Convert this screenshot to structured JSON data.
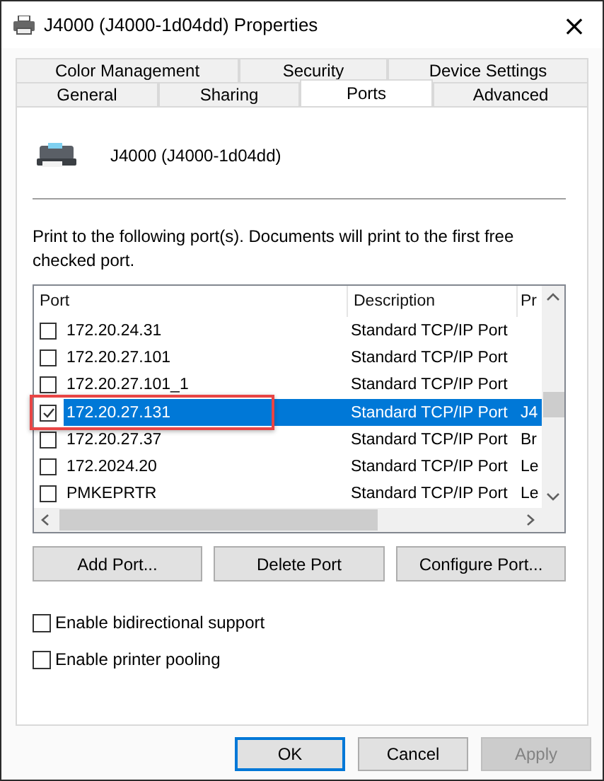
{
  "window": {
    "title": "J4000 (J4000-1d04dd) Properties",
    "close": "×"
  },
  "tab_rows": [
    [
      {
        "label": "Color Management",
        "selected": false
      },
      {
        "label": "Security",
        "selected": false
      },
      {
        "label": "Device Settings",
        "selected": false
      }
    ],
    [
      {
        "label": "General",
        "selected": false
      },
      {
        "label": "Sharing",
        "selected": false
      },
      {
        "label": "Ports",
        "selected": true
      },
      {
        "label": "Advanced",
        "selected": false
      }
    ]
  ],
  "printer_name": "J4000 (J4000-1d04dd)",
  "instructions": "Print to the following port(s). Documents will print to the first free checked port.",
  "port_list": {
    "columns": [
      "Port",
      "Description",
      "Pr"
    ],
    "rows": [
      {
        "port": "172.20.24.31",
        "description": "Standard TCP/IP Port",
        "column_3": "",
        "checked": false,
        "selected": false,
        "highlighted": false
      },
      {
        "port": "172.20.27.101",
        "description": "Standard TCP/IP Port",
        "column_3": "",
        "checked": false,
        "selected": false,
        "highlighted": false
      },
      {
        "port": "172.20.27.101_1",
        "description": "Standard TCP/IP Port",
        "column_3": "",
        "checked": false,
        "selected": false,
        "highlighted": false
      },
      {
        "port": "172.20.27.131",
        "description": "Standard TCP/IP Port",
        "column_3": "J4",
        "checked": true,
        "selected": true,
        "highlighted": true
      },
      {
        "port": "172.20.27.37",
        "description": "Standard TCP/IP Port",
        "column_3": "Br",
        "checked": false,
        "selected": false,
        "highlighted": false
      },
      {
        "port": "172.2024.20",
        "description": "Standard TCP/IP Port",
        "column_3": "Le",
        "checked": false,
        "selected": false,
        "highlighted": false
      },
      {
        "port": "PMKEPRTR",
        "description": "Standard TCP/IP Port",
        "column_3": "Le",
        "checked": false,
        "selected": false,
        "highlighted": false
      }
    ]
  },
  "port_buttons": [
    "Add Port...",
    "Delete Port",
    "Configure Port..."
  ],
  "options": [
    {
      "label": "Enable bidirectional support",
      "checked": false
    },
    {
      "label": "Enable printer pooling",
      "checked": false
    }
  ],
  "dialog_buttons": [
    {
      "label": "OK",
      "default": true,
      "disabled": false
    },
    {
      "label": "Cancel",
      "default": false,
      "disabled": false
    },
    {
      "label": "Apply",
      "default": false,
      "disabled": true
    }
  ]
}
